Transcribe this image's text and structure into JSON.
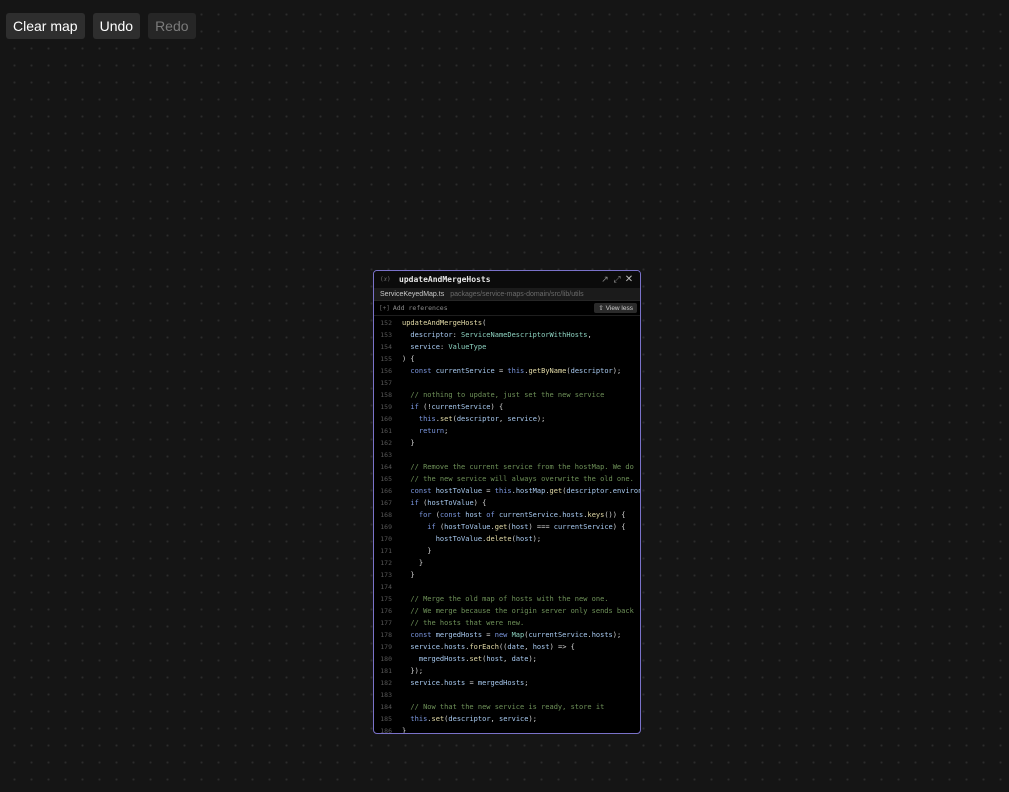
{
  "toolbar": {
    "clear_map": "Clear map",
    "undo": "Undo",
    "redo": "Redo"
  },
  "card": {
    "icon": "(𝑥)",
    "title": "updateAndMergeHosts",
    "file_name": "ServiceKeyedMap.ts",
    "file_path": "packages/service-maps-domain/src/lib/utils",
    "add_references_icon": "[+]",
    "add_references": "Add references",
    "view_less": "⇧ View less",
    "header_icons": [
      "external-link-icon",
      "expand-icon",
      "close-icon"
    ]
  },
  "colors": {
    "background": "#151515",
    "card_border": "#7a72c9",
    "keyword": "#7b97df",
    "function": "#e4dca8",
    "type": "#8ed4c2",
    "variable": "#a9cbf2",
    "comment": "#6f9259"
  },
  "code": [
    {
      "n": "152",
      "t": [
        [
          "fn",
          "updateAndMergeHosts"
        ],
        [
          "pl",
          "("
        ]
      ]
    },
    {
      "n": "153",
      "t": [
        [
          "vr",
          "  descriptor"
        ],
        [
          "pl",
          ": "
        ],
        [
          "ty",
          "ServiceNameDescriptorWithHosts"
        ],
        [
          "pl",
          ","
        ]
      ]
    },
    {
      "n": "154",
      "t": [
        [
          "vr",
          "  service"
        ],
        [
          "pl",
          ": "
        ],
        [
          "ty",
          "ValueType"
        ]
      ]
    },
    {
      "n": "155",
      "t": [
        [
          "pl",
          ") {"
        ]
      ]
    },
    {
      "n": "156",
      "t": [
        [
          "kw",
          "  const "
        ],
        [
          "vr",
          "currentService"
        ],
        [
          "pl",
          " = "
        ],
        [
          "kw",
          "this"
        ],
        [
          "pl",
          "."
        ],
        [
          "fn",
          "getByName"
        ],
        [
          "pl",
          "("
        ],
        [
          "vr",
          "descriptor"
        ],
        [
          "pl",
          ");"
        ]
      ]
    },
    {
      "n": "157",
      "t": []
    },
    {
      "n": "158",
      "t": [
        [
          "cm",
          "  // nothing to update, just set the new service"
        ]
      ]
    },
    {
      "n": "159",
      "t": [
        [
          "kw",
          "  if "
        ],
        [
          "pl",
          "(!"
        ],
        [
          "vr",
          "currentService"
        ],
        [
          "pl",
          ") {"
        ]
      ]
    },
    {
      "n": "160",
      "t": [
        [
          "kw",
          "    this"
        ],
        [
          "pl",
          "."
        ],
        [
          "fn",
          "set"
        ],
        [
          "pl",
          "("
        ],
        [
          "vr",
          "descriptor"
        ],
        [
          "pl",
          ", "
        ],
        [
          "vr",
          "service"
        ],
        [
          "pl",
          ");"
        ]
      ]
    },
    {
      "n": "161",
      "t": [
        [
          "kw",
          "    return"
        ],
        [
          "pl",
          ";"
        ]
      ]
    },
    {
      "n": "162",
      "t": [
        [
          "pl",
          "  }"
        ]
      ]
    },
    {
      "n": "163",
      "t": []
    },
    {
      "n": "164",
      "t": [
        [
          "cm",
          "  // Remove the current service from the hostMap. We do"
        ]
      ]
    },
    {
      "n": "165",
      "t": [
        [
          "cm",
          "  // the new service will always overwrite the old one."
        ]
      ]
    },
    {
      "n": "166",
      "t": [
        [
          "kw",
          "  const "
        ],
        [
          "vr",
          "hostToValue"
        ],
        [
          "pl",
          " = "
        ],
        [
          "kw",
          "this"
        ],
        [
          "pl",
          "."
        ],
        [
          "vr",
          "hostMap"
        ],
        [
          "pl",
          "."
        ],
        [
          "fn",
          "get"
        ],
        [
          "pl",
          "("
        ],
        [
          "vr",
          "descriptor"
        ],
        [
          "pl",
          "."
        ],
        [
          "vr",
          "environ"
        ]
      ]
    },
    {
      "n": "167",
      "t": [
        [
          "kw",
          "  if "
        ],
        [
          "pl",
          "("
        ],
        [
          "vr",
          "hostToValue"
        ],
        [
          "pl",
          ") {"
        ]
      ]
    },
    {
      "n": "168",
      "t": [
        [
          "kw",
          "    for "
        ],
        [
          "pl",
          "("
        ],
        [
          "kw",
          "const "
        ],
        [
          "vr",
          "host"
        ],
        [
          "kw",
          " of "
        ],
        [
          "vr",
          "currentService"
        ],
        [
          "pl",
          "."
        ],
        [
          "vr",
          "hosts"
        ],
        [
          "pl",
          "."
        ],
        [
          "fn",
          "keys"
        ],
        [
          "pl",
          "()) {"
        ]
      ]
    },
    {
      "n": "169",
      "t": [
        [
          "kw",
          "      if "
        ],
        [
          "pl",
          "("
        ],
        [
          "vr",
          "hostToValue"
        ],
        [
          "pl",
          "."
        ],
        [
          "fn",
          "get"
        ],
        [
          "pl",
          "("
        ],
        [
          "vr",
          "host"
        ],
        [
          "pl",
          ") === "
        ],
        [
          "vr",
          "currentService"
        ],
        [
          "pl",
          ") {"
        ]
      ]
    },
    {
      "n": "170",
      "t": [
        [
          "vr",
          "        hostToValue"
        ],
        [
          "pl",
          "."
        ],
        [
          "fn",
          "delete"
        ],
        [
          "pl",
          "("
        ],
        [
          "vr",
          "host"
        ],
        [
          "pl",
          ");"
        ]
      ]
    },
    {
      "n": "171",
      "t": [
        [
          "pl",
          "      }"
        ]
      ]
    },
    {
      "n": "172",
      "t": [
        [
          "pl",
          "    }"
        ]
      ]
    },
    {
      "n": "173",
      "t": [
        [
          "pl",
          "  }"
        ]
      ]
    },
    {
      "n": "174",
      "t": []
    },
    {
      "n": "175",
      "t": [
        [
          "cm",
          "  // Merge the old map of hosts with the new one."
        ]
      ]
    },
    {
      "n": "176",
      "t": [
        [
          "cm",
          "  // We merge because the origin server only sends back"
        ]
      ]
    },
    {
      "n": "177",
      "t": [
        [
          "cm",
          "  // the hosts that were new."
        ]
      ]
    },
    {
      "n": "178",
      "t": [
        [
          "kw",
          "  const "
        ],
        [
          "vr",
          "mergedHosts"
        ],
        [
          "pl",
          " = "
        ],
        [
          "kw",
          "new "
        ],
        [
          "ty",
          "Map"
        ],
        [
          "pl",
          "("
        ],
        [
          "vr",
          "currentService"
        ],
        [
          "pl",
          "."
        ],
        [
          "vr",
          "hosts"
        ],
        [
          "pl",
          ");"
        ]
      ]
    },
    {
      "n": "179",
      "t": [
        [
          "vr",
          "  service"
        ],
        [
          "pl",
          "."
        ],
        [
          "vr",
          "hosts"
        ],
        [
          "pl",
          "."
        ],
        [
          "fn",
          "forEach"
        ],
        [
          "pl",
          "(("
        ],
        [
          "vr",
          "date"
        ],
        [
          "pl",
          ", "
        ],
        [
          "vr",
          "host"
        ],
        [
          "pl",
          ") => {"
        ]
      ]
    },
    {
      "n": "180",
      "t": [
        [
          "vr",
          "    mergedHosts"
        ],
        [
          "pl",
          "."
        ],
        [
          "fn",
          "set"
        ],
        [
          "pl",
          "("
        ],
        [
          "vr",
          "host"
        ],
        [
          "pl",
          ", "
        ],
        [
          "vr",
          "date"
        ],
        [
          "pl",
          ");"
        ]
      ]
    },
    {
      "n": "181",
      "t": [
        [
          "pl",
          "  });"
        ]
      ]
    },
    {
      "n": "182",
      "t": [
        [
          "vr",
          "  service"
        ],
        [
          "pl",
          "."
        ],
        [
          "vr",
          "hosts"
        ],
        [
          "pl",
          " = "
        ],
        [
          "vr",
          "mergedHosts"
        ],
        [
          "pl",
          ";"
        ]
      ]
    },
    {
      "n": "183",
      "t": []
    },
    {
      "n": "184",
      "t": [
        [
          "cm",
          "  // Now that the new service is ready, store it"
        ]
      ]
    },
    {
      "n": "185",
      "t": [
        [
          "kw",
          "  this"
        ],
        [
          "pl",
          "."
        ],
        [
          "fn",
          "set"
        ],
        [
          "pl",
          "("
        ],
        [
          "vr",
          "descriptor"
        ],
        [
          "pl",
          ", "
        ],
        [
          "vr",
          "service"
        ],
        [
          "pl",
          ");"
        ]
      ]
    },
    {
      "n": "186",
      "t": [
        [
          "pl",
          "}"
        ]
      ]
    }
  ]
}
